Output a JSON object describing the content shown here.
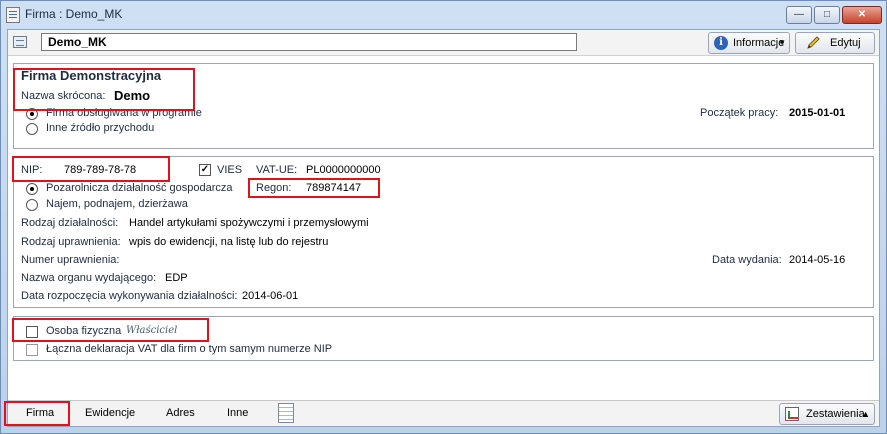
{
  "window": {
    "title": "Firma : Demo_MK",
    "close": "✕",
    "minimize": "—",
    "maximize": "□"
  },
  "toolbar": {
    "name_value": "Demo_MK",
    "info_label": "Informacje",
    "edit_label": "Edytuj"
  },
  "company": {
    "full_name": "Firma Demonstracyjna",
    "short_name_label": "Nazwa skrócona:",
    "short_name_value": "Demo",
    "radio1_label": "Firma obsługiwana w programie",
    "radio2_label": "Inne źródło przychodu",
    "start_label": "Początek pracy:",
    "start_value": "2015-01-01"
  },
  "taxinfo": {
    "nip_label": "NIP:",
    "nip_value": "789-789-78-78",
    "vies_label": "VIES",
    "vatue_label": "VAT-UE:",
    "vatue_value": "PL0000000000",
    "radio_business": "Pozarolnicza działalność gospodarcza",
    "radio_rent": "Najem, podnajem, dzierżawa",
    "regon_label": "Regon:",
    "regon_value": "789874147",
    "activity_label": "Rodzaj działalności:",
    "activity_value": "Handel artykułami spożywczymi i przemysłowymi",
    "entitlement_label": "Rodzaj uprawnienia:",
    "entitlement_value": "wpis do ewidencji, na listę lub do rejestru",
    "number_label": "Numer uprawnienia:",
    "issue_date_label": "Data wydania:",
    "issue_date_value": "2014-05-16",
    "authority_label": "Nazwa organu wydającego:",
    "authority_value": "EDP",
    "activity_start_label": "Data rozpoczęcia wykonywania działalności:",
    "activity_start_value": "2014-06-01"
  },
  "person": {
    "natural_person_label": "Osoba fizyczna",
    "owner_label": "Właściciel",
    "joint_vat_label": "Łączna deklaracja VAT dla firm o tym samym numerze NIP"
  },
  "tabs": [
    "Firma",
    "Ewidencje",
    "Adres",
    "Inne"
  ],
  "bottom": {
    "reports_label": "Zestawienia"
  },
  "icons": [
    "app-icon",
    "company-icon",
    "info-icon",
    "pencil-icon",
    "notes-icon",
    "chart-icon"
  ],
  "colors": {
    "highlight": "#e0131b",
    "window_frame": "#bcd1ea"
  }
}
